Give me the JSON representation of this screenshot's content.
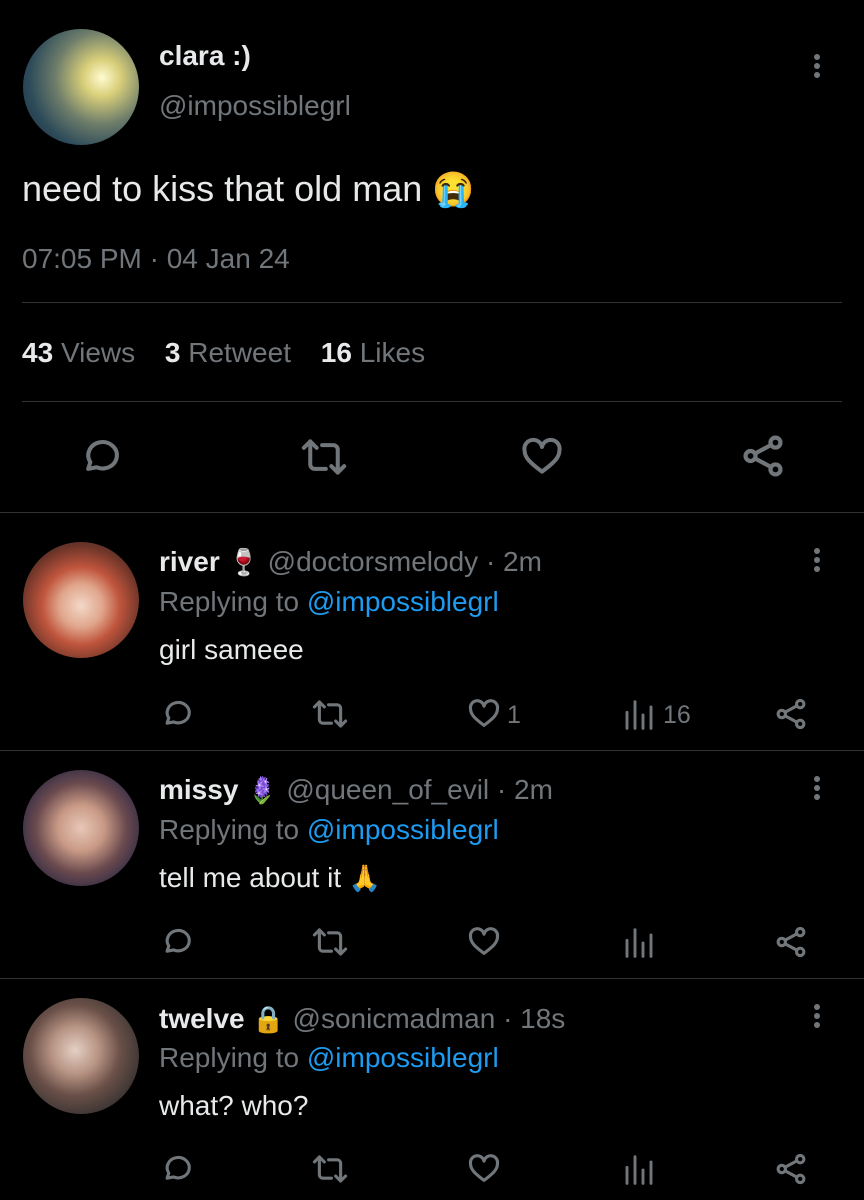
{
  "tweet": {
    "display_name": "clara :)",
    "handle": "@impossiblegrl",
    "text": "need to kiss that old man",
    "emoji": "😭",
    "timestamp": "07:05 PM · 04 Jan 24",
    "stats": {
      "views_count": "43",
      "views_label": "Views",
      "retweet_count": "3",
      "retweet_label": "Retweet",
      "likes_count": "16",
      "likes_label": "Likes"
    }
  },
  "replies": [
    {
      "display_name": "river",
      "name_emoji": "🍷",
      "handle": "@doctorsmelody",
      "time": "· 2m",
      "replying_label": "Replying to",
      "replying_to": "@impossiblegrl",
      "text": "girl sameee",
      "like_count": "1",
      "views_count": "16"
    },
    {
      "display_name": "missy",
      "name_emoji": "🪻",
      "handle": "@queen_of_evil",
      "time": "· 2m",
      "replying_label": "Replying to",
      "replying_to": "@impossiblegrl",
      "text": "tell me about it",
      "text_emoji": "🙏",
      "like_count": "",
      "views_count": ""
    },
    {
      "display_name": "twelve",
      "name_emoji": "🔒",
      "handle": "@sonicmadman",
      "time": "· 18s",
      "replying_label": "Replying to",
      "replying_to": "@impossiblegrl",
      "text": "what? who?",
      "like_count": "",
      "views_count": ""
    }
  ],
  "colors": {
    "background": "#000000",
    "text": "#e7e9ea",
    "muted": "#71767b",
    "link": "#1d9bf0",
    "divider": "#2f3336"
  },
  "icons": [
    "more-options-icon",
    "reply-icon",
    "retweet-icon",
    "like-icon",
    "share-icon",
    "views-icon"
  ]
}
